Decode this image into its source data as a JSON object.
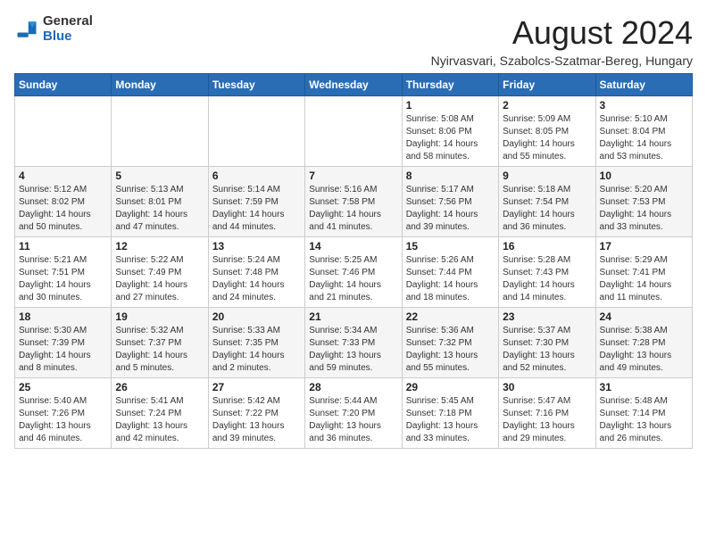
{
  "logo": {
    "general": "General",
    "blue": "Blue"
  },
  "header": {
    "month_year": "August 2024",
    "location": "Nyirvasvari, Szabolcs-Szatmar-Bereg, Hungary"
  },
  "days_of_week": [
    "Sunday",
    "Monday",
    "Tuesday",
    "Wednesday",
    "Thursday",
    "Friday",
    "Saturday"
  ],
  "weeks": [
    [
      {
        "day": "",
        "info": ""
      },
      {
        "day": "",
        "info": ""
      },
      {
        "day": "",
        "info": ""
      },
      {
        "day": "",
        "info": ""
      },
      {
        "day": "1",
        "info": "Sunrise: 5:08 AM\nSunset: 8:06 PM\nDaylight: 14 hours\nand 58 minutes."
      },
      {
        "day": "2",
        "info": "Sunrise: 5:09 AM\nSunset: 8:05 PM\nDaylight: 14 hours\nand 55 minutes."
      },
      {
        "day": "3",
        "info": "Sunrise: 5:10 AM\nSunset: 8:04 PM\nDaylight: 14 hours\nand 53 minutes."
      }
    ],
    [
      {
        "day": "4",
        "info": "Sunrise: 5:12 AM\nSunset: 8:02 PM\nDaylight: 14 hours\nand 50 minutes."
      },
      {
        "day": "5",
        "info": "Sunrise: 5:13 AM\nSunset: 8:01 PM\nDaylight: 14 hours\nand 47 minutes."
      },
      {
        "day": "6",
        "info": "Sunrise: 5:14 AM\nSunset: 7:59 PM\nDaylight: 14 hours\nand 44 minutes."
      },
      {
        "day": "7",
        "info": "Sunrise: 5:16 AM\nSunset: 7:58 PM\nDaylight: 14 hours\nand 41 minutes."
      },
      {
        "day": "8",
        "info": "Sunrise: 5:17 AM\nSunset: 7:56 PM\nDaylight: 14 hours\nand 39 minutes."
      },
      {
        "day": "9",
        "info": "Sunrise: 5:18 AM\nSunset: 7:54 PM\nDaylight: 14 hours\nand 36 minutes."
      },
      {
        "day": "10",
        "info": "Sunrise: 5:20 AM\nSunset: 7:53 PM\nDaylight: 14 hours\nand 33 minutes."
      }
    ],
    [
      {
        "day": "11",
        "info": "Sunrise: 5:21 AM\nSunset: 7:51 PM\nDaylight: 14 hours\nand 30 minutes."
      },
      {
        "day": "12",
        "info": "Sunrise: 5:22 AM\nSunset: 7:49 PM\nDaylight: 14 hours\nand 27 minutes."
      },
      {
        "day": "13",
        "info": "Sunrise: 5:24 AM\nSunset: 7:48 PM\nDaylight: 14 hours\nand 24 minutes."
      },
      {
        "day": "14",
        "info": "Sunrise: 5:25 AM\nSunset: 7:46 PM\nDaylight: 14 hours\nand 21 minutes."
      },
      {
        "day": "15",
        "info": "Sunrise: 5:26 AM\nSunset: 7:44 PM\nDaylight: 14 hours\nand 18 minutes."
      },
      {
        "day": "16",
        "info": "Sunrise: 5:28 AM\nSunset: 7:43 PM\nDaylight: 14 hours\nand 14 minutes."
      },
      {
        "day": "17",
        "info": "Sunrise: 5:29 AM\nSunset: 7:41 PM\nDaylight: 14 hours\nand 11 minutes."
      }
    ],
    [
      {
        "day": "18",
        "info": "Sunrise: 5:30 AM\nSunset: 7:39 PM\nDaylight: 14 hours\nand 8 minutes."
      },
      {
        "day": "19",
        "info": "Sunrise: 5:32 AM\nSunset: 7:37 PM\nDaylight: 14 hours\nand 5 minutes."
      },
      {
        "day": "20",
        "info": "Sunrise: 5:33 AM\nSunset: 7:35 PM\nDaylight: 14 hours\nand 2 minutes."
      },
      {
        "day": "21",
        "info": "Sunrise: 5:34 AM\nSunset: 7:33 PM\nDaylight: 13 hours\nand 59 minutes."
      },
      {
        "day": "22",
        "info": "Sunrise: 5:36 AM\nSunset: 7:32 PM\nDaylight: 13 hours\nand 55 minutes."
      },
      {
        "day": "23",
        "info": "Sunrise: 5:37 AM\nSunset: 7:30 PM\nDaylight: 13 hours\nand 52 minutes."
      },
      {
        "day": "24",
        "info": "Sunrise: 5:38 AM\nSunset: 7:28 PM\nDaylight: 13 hours\nand 49 minutes."
      }
    ],
    [
      {
        "day": "25",
        "info": "Sunrise: 5:40 AM\nSunset: 7:26 PM\nDaylight: 13 hours\nand 46 minutes."
      },
      {
        "day": "26",
        "info": "Sunrise: 5:41 AM\nSunset: 7:24 PM\nDaylight: 13 hours\nand 42 minutes."
      },
      {
        "day": "27",
        "info": "Sunrise: 5:42 AM\nSunset: 7:22 PM\nDaylight: 13 hours\nand 39 minutes."
      },
      {
        "day": "28",
        "info": "Sunrise: 5:44 AM\nSunset: 7:20 PM\nDaylight: 13 hours\nand 36 minutes."
      },
      {
        "day": "29",
        "info": "Sunrise: 5:45 AM\nSunset: 7:18 PM\nDaylight: 13 hours\nand 33 minutes."
      },
      {
        "day": "30",
        "info": "Sunrise: 5:47 AM\nSunset: 7:16 PM\nDaylight: 13 hours\nand 29 minutes."
      },
      {
        "day": "31",
        "info": "Sunrise: 5:48 AM\nSunset: 7:14 PM\nDaylight: 13 hours\nand 26 minutes."
      }
    ]
  ]
}
